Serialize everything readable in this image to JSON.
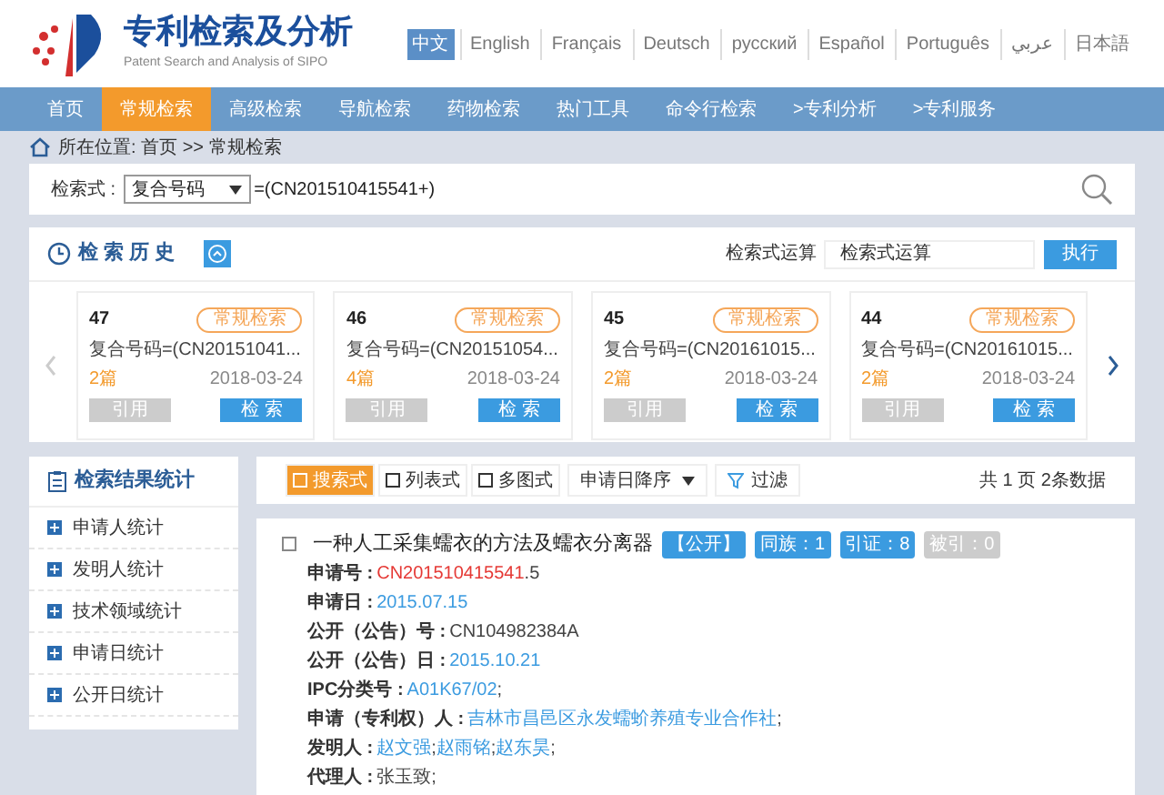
{
  "header": {
    "title": "专利检索及分析",
    "subtitle": "Patent Search and Analysis of SIPO",
    "languages": [
      {
        "label": "中文",
        "selected": true
      },
      {
        "label": "English",
        "selected": false
      },
      {
        "label": "Français",
        "selected": false
      },
      {
        "label": "Deutsch",
        "selected": false
      },
      {
        "label": "русский",
        "selected": false
      },
      {
        "label": "Español",
        "selected": false
      },
      {
        "label": "Português",
        "selected": false
      },
      {
        "label": "عربي",
        "selected": false
      },
      {
        "label": "日本語",
        "selected": false
      }
    ]
  },
  "nav": [
    {
      "label": "首页",
      "selected": false
    },
    {
      "label": "常规检索",
      "selected": true
    },
    {
      "label": "高级检索",
      "selected": false
    },
    {
      "label": "导航检索",
      "selected": false
    },
    {
      "label": "药物检索",
      "selected": false
    },
    {
      "label": "热门工具",
      "selected": false
    },
    {
      "label": "命令行检索",
      "selected": false
    },
    {
      "label": ">专利分析",
      "selected": false
    },
    {
      "label": ">专利服务",
      "selected": false
    }
  ],
  "breadcrumb": "所在位置: 首页 >> 常规检索",
  "search": {
    "label": "检索式 :",
    "field": "复合号码",
    "value": "=(CN201510415541+)"
  },
  "history": {
    "title": "检 索 历 史",
    "calc_label": "检索式运算",
    "calc_value": "检索式运算",
    "run_button": "执行",
    "cards": [
      {
        "number": "47",
        "tag": "常规检索",
        "query": "复合号码=(CN20151041...",
        "count": "2篇",
        "date": "2018-03-24",
        "cite": "引用",
        "search": "检 索"
      },
      {
        "number": "46",
        "tag": "常规检索",
        "query": "复合号码=(CN20151054...",
        "count": "4篇",
        "date": "2018-03-24",
        "cite": "引用",
        "search": "检 索"
      },
      {
        "number": "45",
        "tag": "常规检索",
        "query": "复合号码=(CN20161015...",
        "count": "2篇",
        "date": "2018-03-24",
        "cite": "引用",
        "search": "检 索"
      },
      {
        "number": "44",
        "tag": "常规检索",
        "query": "复合号码=(CN20161015...",
        "count": "2篇",
        "date": "2018-03-24",
        "cite": "引用",
        "search": "检 索"
      }
    ]
  },
  "stats": {
    "title": "检索结果统计",
    "items": [
      "申请人统计",
      "发明人统计",
      "技术领域统计",
      "申请日统计",
      "公开日统计"
    ]
  },
  "toolbar": {
    "views": [
      {
        "label": "搜索式",
        "selected": true
      },
      {
        "label": "列表式",
        "selected": false
      },
      {
        "label": "多图式",
        "selected": false
      }
    ],
    "sort": "申请日降序",
    "filter": "过滤",
    "summary": "共 1 页 2条数据"
  },
  "result": {
    "checked": false,
    "title": "一种人工采集蠕衣的方法及蠕衣分离器",
    "badges": [
      {
        "label": "【公开】",
        "disabled": false
      },
      {
        "label": "同族：1",
        "disabled": false
      },
      {
        "label": "引证：8",
        "disabled": false
      },
      {
        "label": "被引：0",
        "disabled": true
      }
    ],
    "fields": [
      {
        "label": "申请号 :",
        "parts": [
          {
            "text": "CN201510415541",
            "kind": "match"
          },
          {
            "text": ".5",
            "kind": "plain"
          }
        ]
      },
      {
        "label": "申请日 :",
        "parts": [
          {
            "text": "2015.07.15",
            "kind": "link"
          }
        ]
      },
      {
        "label": "公开（公告）号 :",
        "parts": [
          {
            "text": "CN104982384A",
            "kind": "plain"
          }
        ]
      },
      {
        "label": "公开（公告）日 :",
        "parts": [
          {
            "text": "2015.10.21",
            "kind": "link"
          }
        ]
      },
      {
        "label": "IPC分类号 :",
        "parts": [
          {
            "text": "A01K67/02",
            "kind": "link"
          },
          {
            "text": ";",
            "kind": "plain"
          }
        ]
      },
      {
        "label": "申请（专利权）人 :",
        "parts": [
          {
            "text": "吉林市昌邑区永发蠕蚧养殖专业合作社",
            "kind": "link"
          },
          {
            "text": ";",
            "kind": "plain"
          }
        ]
      },
      {
        "label": "发明人 :",
        "parts": [
          {
            "text": "赵文强",
            "kind": "link"
          },
          {
            "text": ";",
            "kind": "plain"
          },
          {
            "text": "赵雨铭",
            "kind": "link"
          },
          {
            "text": ";",
            "kind": "plain"
          },
          {
            "text": "赵东昊",
            "kind": "link"
          },
          {
            "text": ";",
            "kind": "plain"
          }
        ]
      },
      {
        "label": "代理人 :",
        "parts": [
          {
            "text": "张玉致;",
            "kind": "plain"
          }
        ]
      }
    ]
  }
}
